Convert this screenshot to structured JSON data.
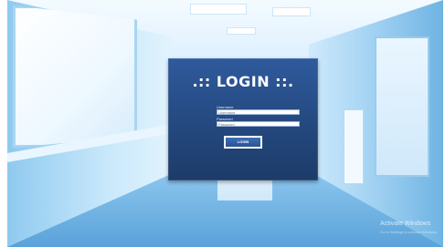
{
  "login": {
    "title": ".:: LOGIN ::.",
    "username_label": "Username",
    "username_placeholder": "Username",
    "password_label": "Password",
    "password_placeholder": "Password",
    "button_label": "LOGIN"
  },
  "watermark": {
    "title": "Activate Windows",
    "subtitle": "Go to Settings to activate Windows."
  },
  "colors": {
    "panel": "#24497f",
    "background": "#9fd3f5"
  }
}
